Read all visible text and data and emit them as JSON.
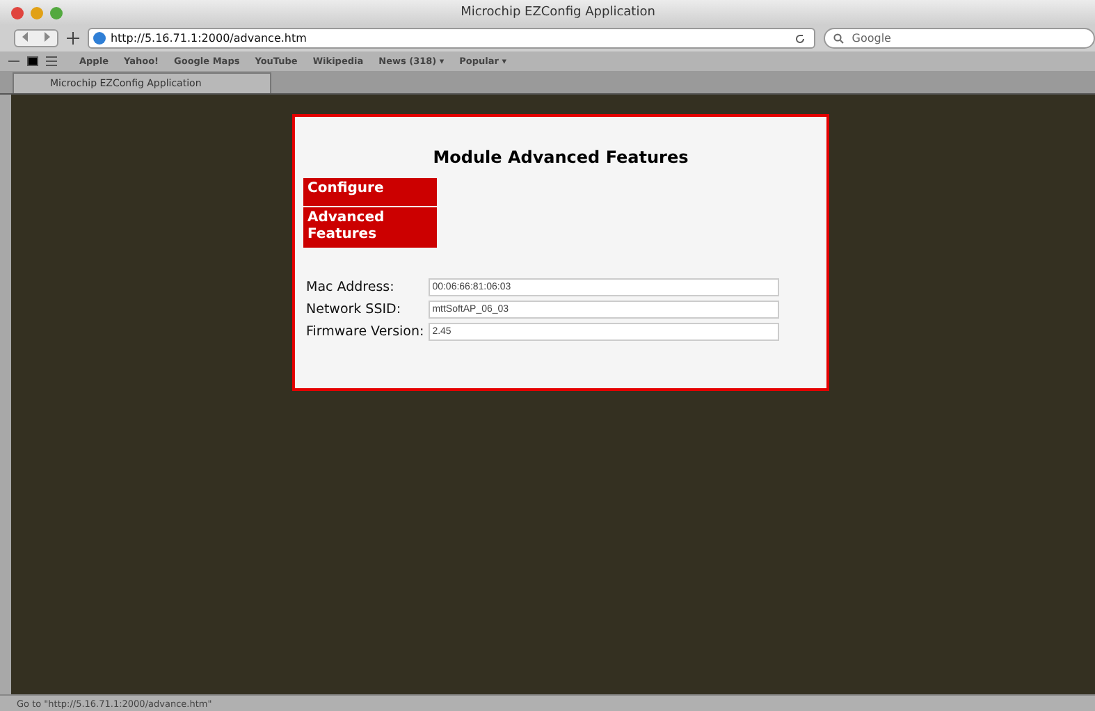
{
  "window": {
    "title": "Microchip EZConfig Application"
  },
  "toolbar": {
    "url": "http://5.16.71.1:2000/advance.htm",
    "search_placeholder": "Google"
  },
  "bookmarks": [
    "Apple",
    "Yahoo!",
    "Google Maps",
    "YouTube",
    "Wikipedia",
    "News (318) ▾",
    "Popular ▾"
  ],
  "tabs": [
    {
      "label": "Microchip EZConfig Application",
      "selected": true
    }
  ],
  "page": {
    "heading": "Module Advanced Features",
    "menu": [
      {
        "label": "Configure"
      },
      {
        "label": "Advanced Features"
      }
    ],
    "fields": [
      {
        "label": "Mac Address:",
        "value": "00:06:66:81:06:03"
      },
      {
        "label": "Network SSID:",
        "value": "mttSoftAP_06_03"
      },
      {
        "label": "Firmware Version:",
        "value": "2.45"
      }
    ]
  },
  "status_bar": "Go to \"http://5.16.71.1:2000/advance.htm\""
}
